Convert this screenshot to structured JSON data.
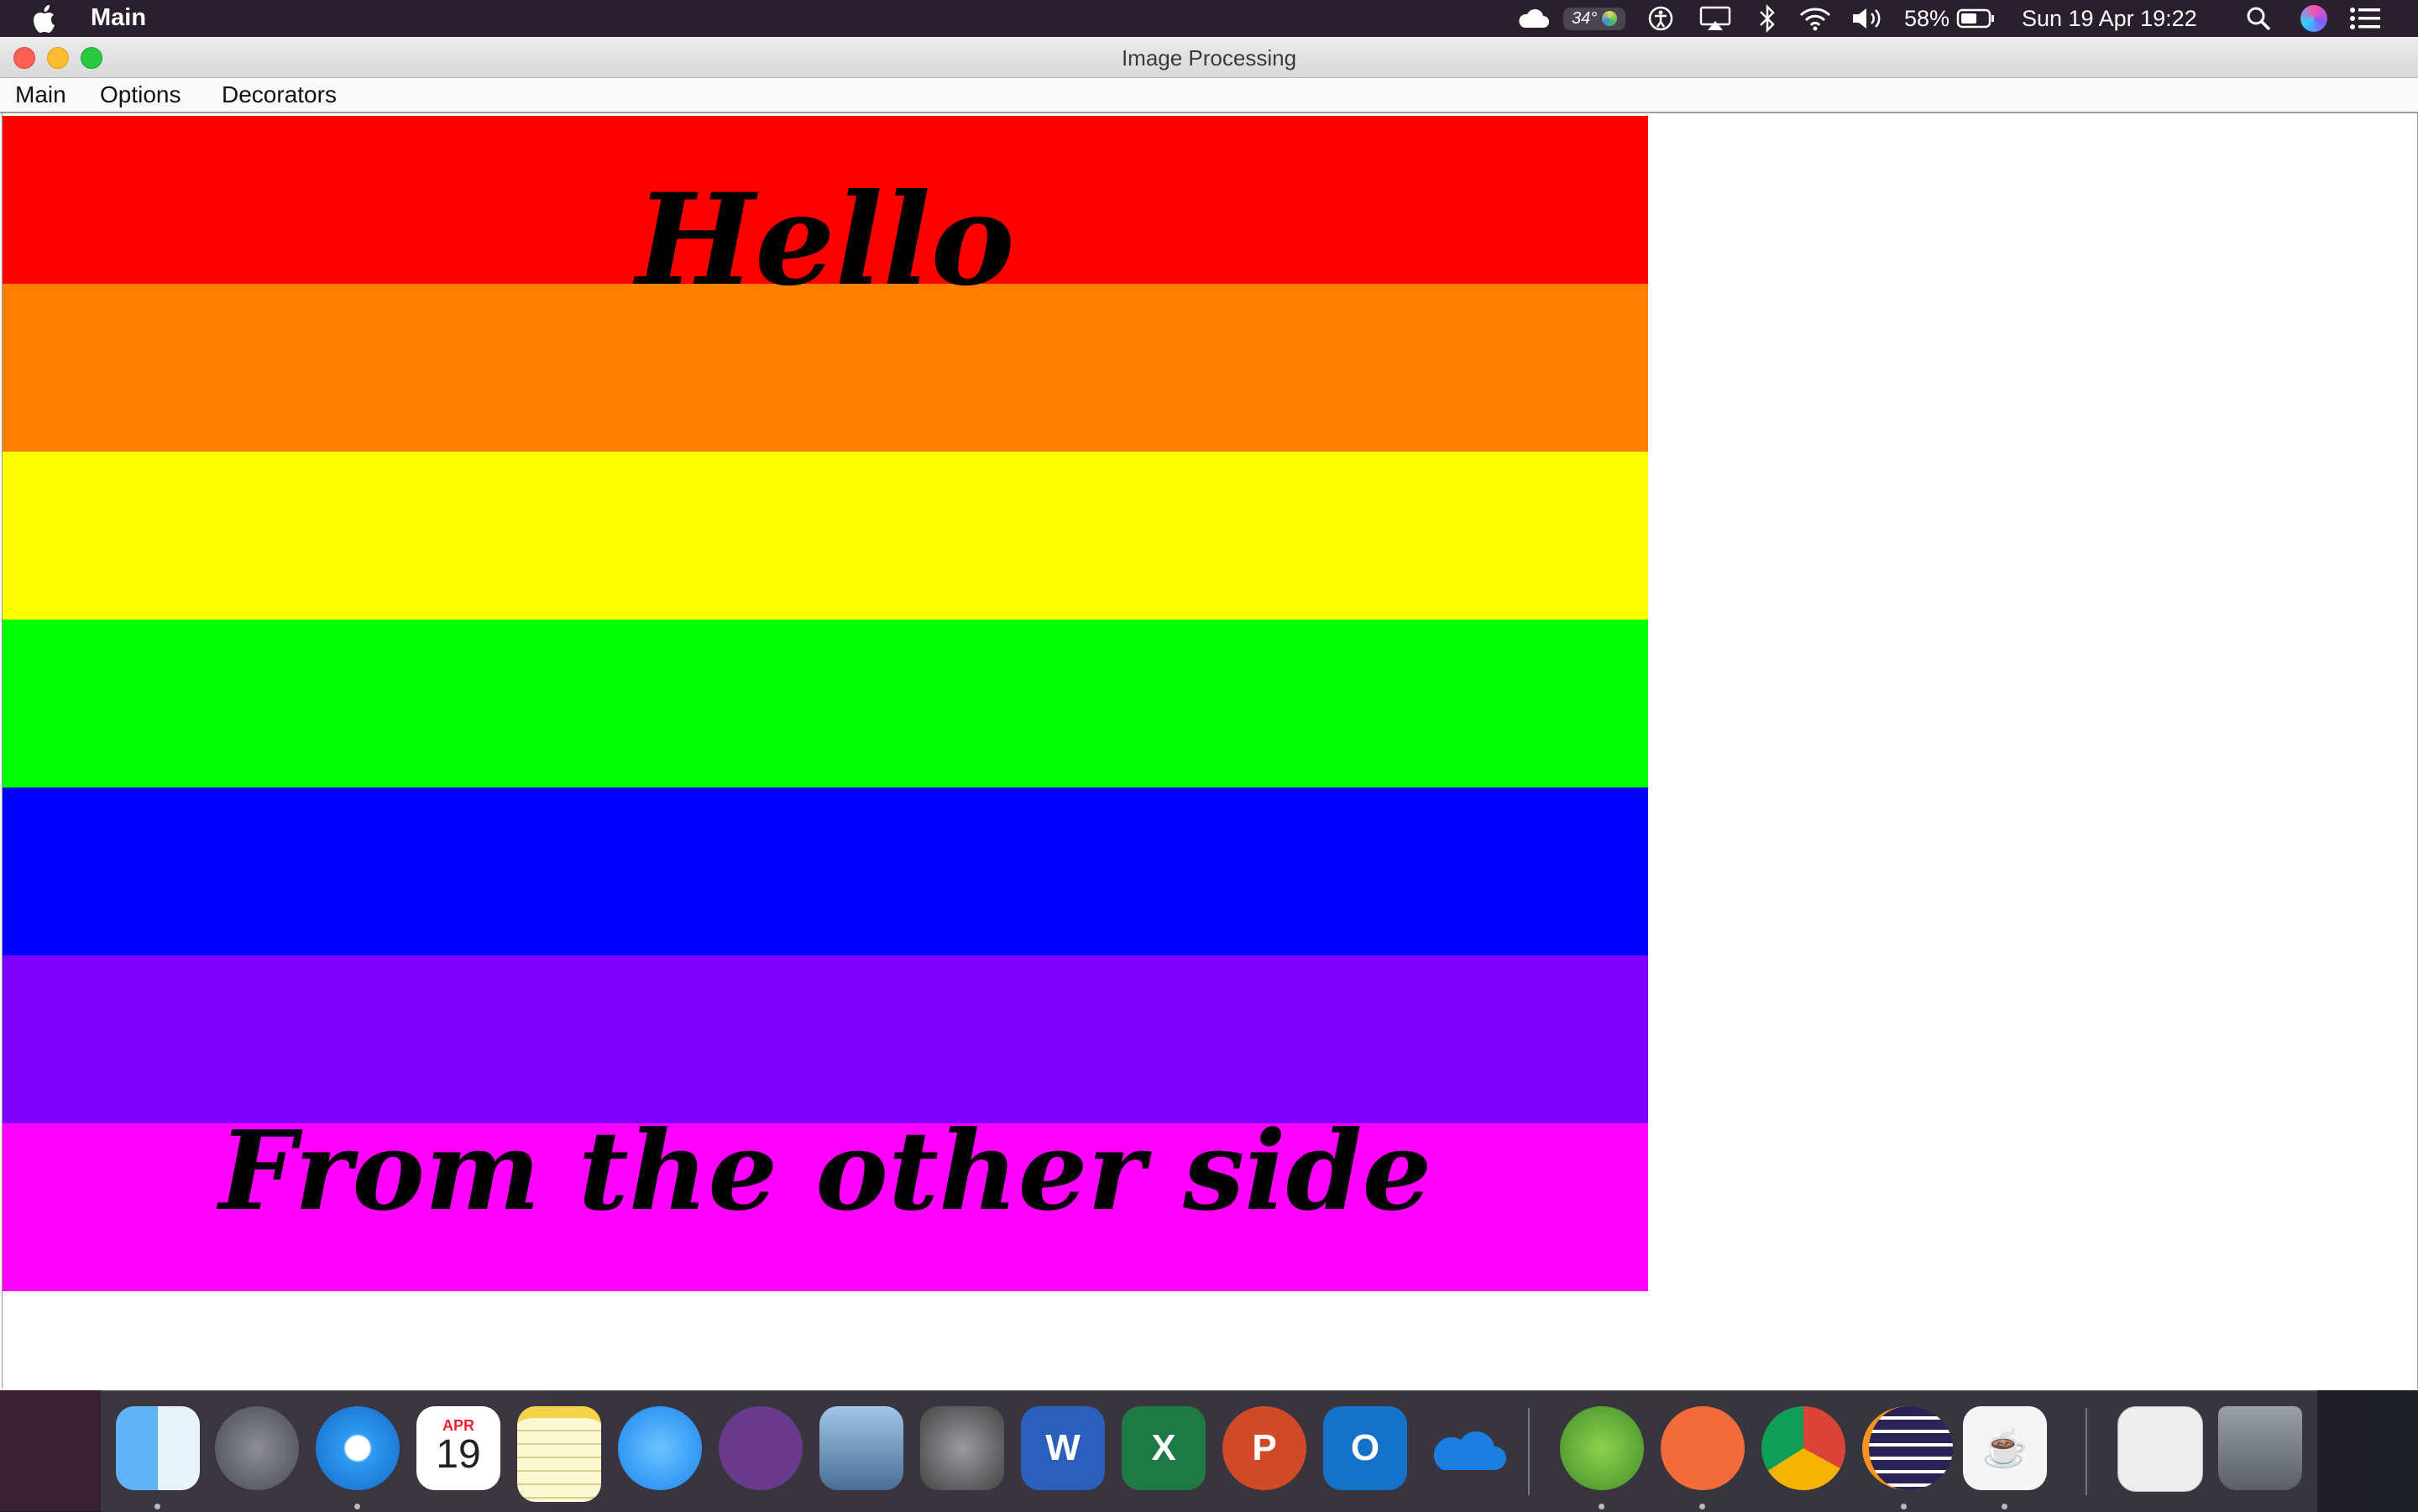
{
  "menubar": {
    "app_name": "Main",
    "temperature": "34°",
    "battery": "58%",
    "datetime": "Sun 19 Apr  19:22"
  },
  "window": {
    "title": "Image Processing",
    "menu": [
      "Main",
      "Options",
      "Decorators"
    ]
  },
  "image": {
    "stripe_colors": [
      "#ff0000",
      "#ff8000",
      "#ffff00",
      "#00ff00",
      "#0000ff",
      "#8000ff",
      "#ff00ff"
    ],
    "top_text": "Hello",
    "bottom_text": "From the other side"
  },
  "dock": {
    "calendar_month": "APR",
    "calendar_day": "19",
    "apps": [
      {
        "name": "finder-icon",
        "running": true
      },
      {
        "name": "launchpad-icon",
        "running": false
      },
      {
        "name": "safari-icon",
        "running": true
      },
      {
        "name": "calendar-icon",
        "running": false
      },
      {
        "name": "notes-icon",
        "running": false
      },
      {
        "name": "messages-icon",
        "running": false
      },
      {
        "name": "github-icon",
        "running": false
      },
      {
        "name": "preview-icon",
        "running": false
      },
      {
        "name": "system-preferences-icon",
        "running": false
      },
      {
        "name": "word-icon",
        "label": "W",
        "running": false
      },
      {
        "name": "excel-icon",
        "label": "X",
        "running": false
      },
      {
        "name": "powerpoint-icon",
        "label": "P",
        "running": false
      },
      {
        "name": "outlook-icon",
        "label": "O",
        "running": false
      },
      {
        "name": "onedrive-icon",
        "running": false
      },
      {
        "name": "spring-icon",
        "running": true
      },
      {
        "name": "postman-icon",
        "running": true
      },
      {
        "name": "chrome-icon",
        "running": false
      },
      {
        "name": "eclipse-icon",
        "running": true
      },
      {
        "name": "java-icon",
        "running": true
      },
      {
        "name": "documents-stack-icon",
        "running": false
      },
      {
        "name": "trash-icon",
        "running": false
      }
    ]
  }
}
